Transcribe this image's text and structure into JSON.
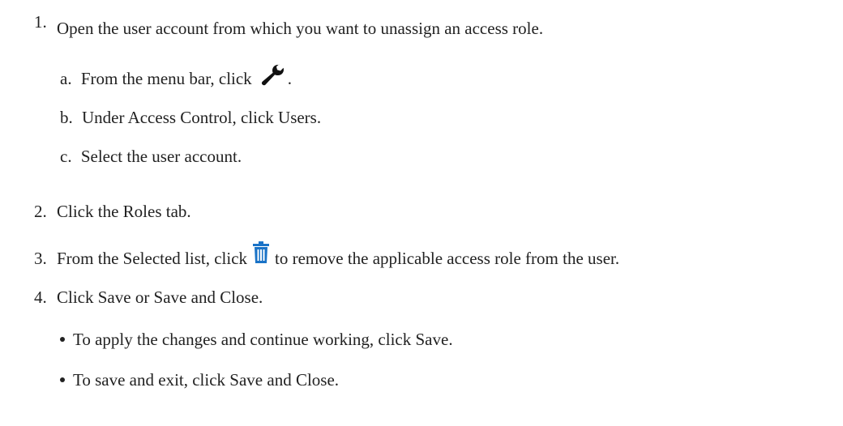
{
  "steps": [
    {
      "number": "1.",
      "text": "Open the user account from which you want to unassign an access role.",
      "substeps": [
        {
          "letter": "a.",
          "text_before": "From the menu bar, click",
          "icon": "wrench-icon",
          "text_after": "."
        },
        {
          "letter": "b.",
          "text": "Under Access Control, click Users."
        },
        {
          "letter": "c.",
          "text": "Select the user account."
        }
      ]
    },
    {
      "number": "2.",
      "text": "Click the Roles tab."
    },
    {
      "number": "3.",
      "text_before": "From the Selected list, click",
      "icon": "trash-icon",
      "text_after": "to remove the applicable access role from the user."
    },
    {
      "number": "4.",
      "text": "Click Save or Save and Close.",
      "bullets": [
        "To apply the changes and continue working, click Save.",
        "To save and exit, click Save and Close."
      ]
    }
  ],
  "colors": {
    "text": "#222222",
    "trash_icon": "#1a73c7",
    "wrench_icon": "#111111"
  }
}
